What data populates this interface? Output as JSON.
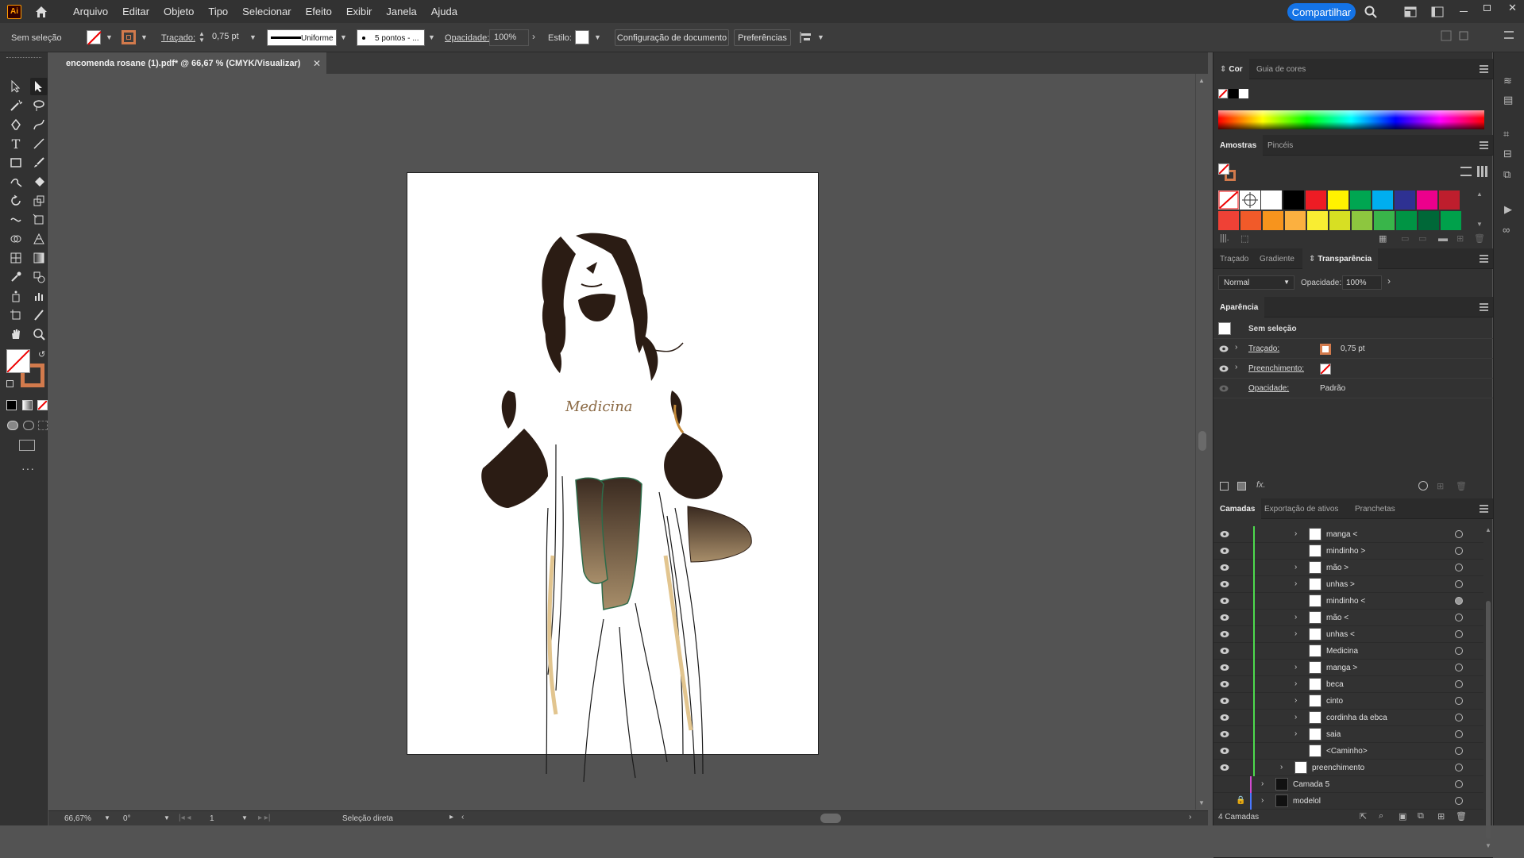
{
  "app": {
    "logo": "Ai",
    "menus": [
      "Arquivo",
      "Editar",
      "Objeto",
      "Tipo",
      "Selecionar",
      "Efeito",
      "Exibir",
      "Janela",
      "Ajuda"
    ],
    "share_label": "Compartilhar"
  },
  "control_bar": {
    "selection": "Sem seleção",
    "stroke_label": "Traçado:",
    "stroke_value": "0,75 pt",
    "stroke_style": "Uniforme",
    "brush": "5 pontos - ...",
    "opacity_label": "Opacidade:",
    "opacity_value": "100%",
    "style_label": "Estilo:",
    "doc_setup": "Configuração de documento",
    "prefs": "Preferências"
  },
  "document": {
    "tab_title": "encomenda rosane (1).pdf* @ 66,67 % (CMYK/Visualizar)",
    "artwork_text": "Medicina"
  },
  "status_bar": {
    "zoom": "66,67%",
    "rotation": "0°",
    "artboard": "1",
    "tool": "Seleção direta"
  },
  "panels": {
    "color_tabs": [
      "Cor",
      "Guia de cores"
    ],
    "swatches_tabs": [
      "Amostras",
      "Pincéis"
    ],
    "transparency_tabs": [
      "Traçado",
      "Gradiente",
      "Transparência"
    ],
    "blend_mode": "Normal",
    "transparency_opacity_label": "Opacidade:",
    "transparency_opacity_value": "100%",
    "appearance_title": "Aparência",
    "appearance_selection": "Sem seleção",
    "appearance_stroke_label": "Traçado:",
    "appearance_stroke_value": "0,75 pt",
    "appearance_fill_label": "Preenchimento:",
    "appearance_opacity_label": "Opacidade:",
    "appearance_opacity_value": "Padrão",
    "layers_tabs": [
      "Camadas",
      "Exportação de ativos",
      "Pranchetas"
    ],
    "layers_count": "4 Camadas"
  },
  "swatch_colors": {
    "row1": [
      "#ffffff",
      "#000000",
      "#ed1c24",
      "#fff200",
      "#00a651",
      "#00aeef",
      "#2e3192",
      "#ec008c",
      "#be1e2d"
    ],
    "row2": [
      "#ef4136",
      "#f15a29",
      "#f7941d",
      "#fbb040",
      "#f9ed32",
      "#d7df23",
      "#8dc63f",
      "#39b54a",
      "#009444",
      "#006838",
      "#00a14b"
    ]
  },
  "layers": [
    {
      "name": "manga <",
      "arrow": true,
      "indent": 2,
      "target_filled": false
    },
    {
      "name": "mindinho >",
      "arrow": false,
      "indent": 2,
      "target_filled": false
    },
    {
      "name": "mão >",
      "arrow": true,
      "indent": 2,
      "target_filled": false
    },
    {
      "name": "unhas >",
      "arrow": true,
      "indent": 2,
      "target_filled": false
    },
    {
      "name": "mindinho <",
      "arrow": false,
      "indent": 2,
      "target_filled": true
    },
    {
      "name": "mão <",
      "arrow": true,
      "indent": 2,
      "target_filled": false
    },
    {
      "name": "unhas <",
      "arrow": true,
      "indent": 2,
      "target_filled": false
    },
    {
      "name": "Medicina",
      "arrow": false,
      "indent": 2,
      "target_filled": false
    },
    {
      "name": "manga >",
      "arrow": true,
      "indent": 2,
      "target_filled": false
    },
    {
      "name": "beca",
      "arrow": true,
      "indent": 2,
      "target_filled": false
    },
    {
      "name": "cinto",
      "arrow": true,
      "indent": 2,
      "target_filled": false
    },
    {
      "name": "cordinha da ebca",
      "arrow": true,
      "indent": 2,
      "target_filled": false
    },
    {
      "name": "saia",
      "arrow": true,
      "indent": 2,
      "target_filled": false
    },
    {
      "name": "<Caminho>",
      "arrow": false,
      "indent": 2,
      "target_filled": false
    },
    {
      "name": "preenchimento",
      "arrow": true,
      "indent": 1,
      "target_filled": false
    },
    {
      "name": "Camada 5",
      "arrow": true,
      "indent": 0,
      "target_filled": false
    },
    {
      "name": "modelol",
      "arrow": true,
      "indent": 0,
      "target_filled": false
    }
  ]
}
